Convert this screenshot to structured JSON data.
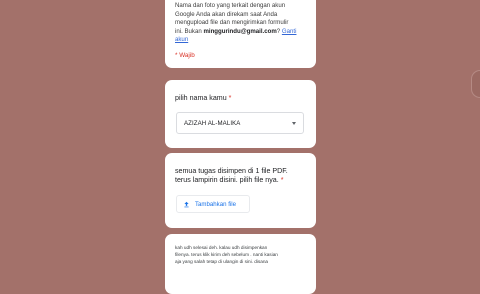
{
  "info": {
    "line1": "Nama dan foto yang terkait dengan akun",
    "line2": "Google Anda akan direkam saat Anda",
    "line3": "mengupload file dan mengirimkan formulir",
    "line4_prefix": "ini. Bukan",
    "email": "minggurindu@gmail.com",
    "line4_suffix": "?",
    "switch_link_a": "Ganti",
    "switch_link_b": "akun",
    "required_note": "* Wajib"
  },
  "question_name": {
    "title": "pilih nama kamu",
    "required_mark": "*",
    "selected": "AZIZAH AL-MALIKA",
    "caret_icon": "dropdown-caret-icon"
  },
  "question_file": {
    "title_line1": "semua tugas disimpen di 1 file PDF.",
    "title_line2": "terus lampirin disini. pilih file nya.",
    "required_mark": "*",
    "upload_label": "Tambahkan file",
    "upload_icon": "upload-icon",
    "accent": "#1a73e8"
  },
  "bottom": {
    "line1": "kah udh selesai deh. kalau udh disimpenkan",
    "line2": "filenya. terus klik kirim deh sebelum . nanti kasian",
    "line3": "aja yang salah tetap di ulangin di sini. disana"
  },
  "colors": {
    "background": "#a3716a",
    "required": "#d93025"
  }
}
